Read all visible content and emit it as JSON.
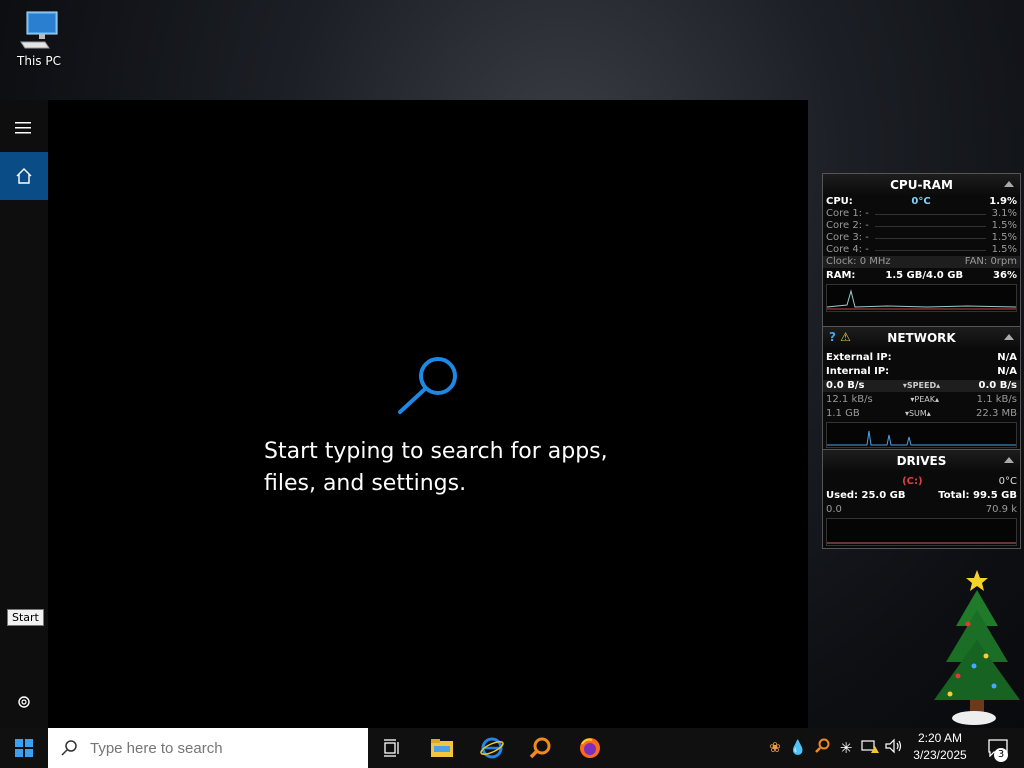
{
  "desktop": {
    "this_pc_label": "This PC"
  },
  "start_menu": {
    "search_hint": "Start typing to search for apps, files, and settings.",
    "tooltip": "Start"
  },
  "widgets": {
    "cpu_ram": {
      "title": "CPU-RAM",
      "cpu_label": "CPU:",
      "cpu_temp": "0°C",
      "cpu_pct": "1.9%",
      "cores": [
        {
          "label": "Core 1:",
          "value": "-",
          "pct": "3.1%"
        },
        {
          "label": "Core 2:",
          "value": "-",
          "pct": "1.5%"
        },
        {
          "label": "Core 3:",
          "value": "-",
          "pct": "1.5%"
        },
        {
          "label": "Core 4:",
          "value": "-",
          "pct": "1.5%"
        }
      ],
      "clock": "Clock: 0 MHz",
      "fan": "FAN: 0rpm",
      "ram_label": "RAM:",
      "ram_value": "1.5 GB/4.0 GB",
      "ram_pct": "36%"
    },
    "network": {
      "title": "NETWORK",
      "ext_ip_label": "External IP:",
      "ext_ip": "N/A",
      "int_ip_label": "Internal IP:",
      "int_ip": "N/A",
      "speed_left": "0.0 B/s",
      "speed_label": "SPEED",
      "speed_right": "0.0 B/s",
      "peak_left": "12.1 kB/s",
      "peak_label": "PEAK",
      "peak_right": "1.1 kB/s",
      "sum_left": "1.1 GB",
      "sum_label": "SUM",
      "sum_right": "22.3 MB"
    },
    "drives": {
      "title": "DRIVES",
      "drive_letter": "(C:)",
      "temp": "0°C",
      "used": "Used: 25.0 GB",
      "total": "Total: 99.5 GB",
      "read": "0.0",
      "write": "70.9 k"
    }
  },
  "taskbar": {
    "search_placeholder": "Type here to search",
    "time": "2:20 AM",
    "date": "3/23/2025",
    "notification_count": "3"
  },
  "colors": {
    "accent": "#0a4d86",
    "search_icon_blue": "#1e88e5"
  }
}
